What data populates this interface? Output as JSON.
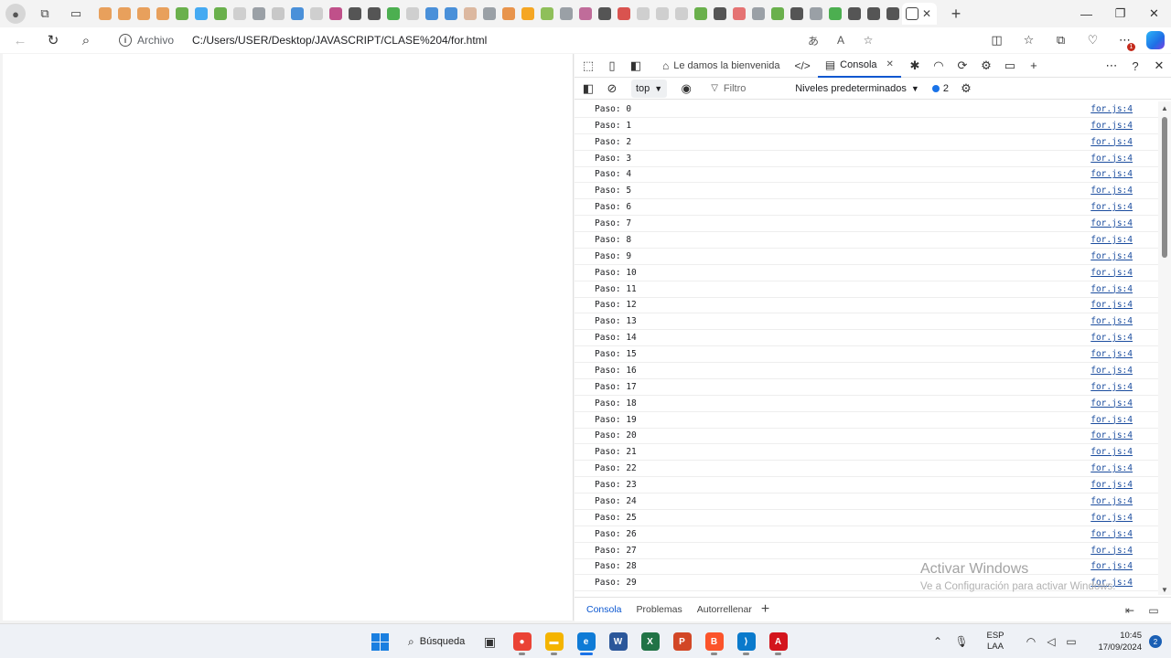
{
  "browser": {
    "back_icon": "arrow-left-icon",
    "reload_icon": "reload-icon",
    "search_icon": "search-icon",
    "site_info_label": "Archivo",
    "url": "C:/Users/USER/Desktop/JAVASCRIPT/CLASE%204/for.html",
    "window_controls": {
      "minimize": "—",
      "maximize": "❐",
      "close": "✕"
    }
  },
  "tabs": {
    "pinned_colors": [
      "#e8a05c",
      "#e8a05c",
      "#e8a05c",
      "#e8a05c",
      "#6ab04c",
      "#45aaf2",
      "#6ab04c",
      "#cfcfcf",
      "#9aa0a6",
      "#c8c8c8",
      "#4a90d9",
      "#cfcfcf",
      "#c0508a",
      "#555555",
      "#555555",
      "#4caf50",
      "#cfcfcf",
      "#4a90d9",
      "#4a90d9",
      "#dcb8a0",
      "#9aa0a6",
      "#e8944c",
      "#f5a623",
      "#8fbf5a",
      "#9aa0a6",
      "#c06c9a",
      "#555555",
      "#d9534f",
      "#cfcfcf",
      "#cfcfcf",
      "#cfcfcf",
      "#6ab04c",
      "#555555",
      "#e57373",
      "#9aa0a6",
      "#6ab04c",
      "#555555",
      "#9aa0a6",
      "#4caf50",
      "#555555",
      "#555555",
      "#555555"
    ],
    "close_glyph": "✕",
    "new_tab_glyph": "+"
  },
  "devtools": {
    "tabs": [
      {
        "label": "Le damos la bienvenida",
        "icon": "home-icon"
      },
      {
        "label": "",
        "icon": "code-icon"
      },
      {
        "label": "Consola",
        "icon": "console-icon",
        "active": true
      }
    ],
    "context": "top",
    "filter_placeholder": "Filtro",
    "levels": "Niveles predeterminados",
    "message_count": "2",
    "console": [
      {
        "text": "Paso: 0",
        "source": "for.js:4"
      },
      {
        "text": "Paso: 1",
        "source": "for.js:4"
      },
      {
        "text": "Paso: 2",
        "source": "for.js:4"
      },
      {
        "text": "Paso: 3",
        "source": "for.js:4"
      },
      {
        "text": "Paso: 4",
        "source": "for.js:4"
      },
      {
        "text": "Paso: 5",
        "source": "for.js:4"
      },
      {
        "text": "Paso: 6",
        "source": "for.js:4"
      },
      {
        "text": "Paso: 7",
        "source": "for.js:4"
      },
      {
        "text": "Paso: 8",
        "source": "for.js:4"
      },
      {
        "text": "Paso: 9",
        "source": "for.js:4"
      },
      {
        "text": "Paso: 10",
        "source": "for.js:4"
      },
      {
        "text": "Paso: 11",
        "source": "for.js:4"
      },
      {
        "text": "Paso: 12",
        "source": "for.js:4"
      },
      {
        "text": "Paso: 13",
        "source": "for.js:4"
      },
      {
        "text": "Paso: 14",
        "source": "for.js:4"
      },
      {
        "text": "Paso: 15",
        "source": "for.js:4"
      },
      {
        "text": "Paso: 16",
        "source": "for.js:4"
      },
      {
        "text": "Paso: 17",
        "source": "for.js:4"
      },
      {
        "text": "Paso: 18",
        "source": "for.js:4"
      },
      {
        "text": "Paso: 19",
        "source": "for.js:4"
      },
      {
        "text": "Paso: 20",
        "source": "for.js:4"
      },
      {
        "text": "Paso: 21",
        "source": "for.js:4"
      },
      {
        "text": "Paso: 22",
        "source": "for.js:4"
      },
      {
        "text": "Paso: 23",
        "source": "for.js:4"
      },
      {
        "text": "Paso: 24",
        "source": "for.js:4"
      },
      {
        "text": "Paso: 25",
        "source": "for.js:4"
      },
      {
        "text": "Paso: 26",
        "source": "for.js:4"
      },
      {
        "text": "Paso: 27",
        "source": "for.js:4"
      },
      {
        "text": "Paso: 28",
        "source": "for.js:4"
      },
      {
        "text": "Paso: 29",
        "source": "for.js:4"
      }
    ],
    "drawer_tabs": [
      "Consola",
      "Problemas",
      "Autorrellenar"
    ],
    "watermark_title": "Activar Windows",
    "watermark_sub": "Ve a Configuración para activar Windows."
  },
  "taskbar": {
    "search_label": "Búsqueda",
    "apps": [
      {
        "name": "taskview",
        "color": "#333333",
        "glyph": "▣"
      },
      {
        "name": "chrome",
        "color": "#ea4335",
        "glyph": "●"
      },
      {
        "name": "explorer",
        "color": "#f4b400",
        "glyph": "▬"
      },
      {
        "name": "edge",
        "color": "#0f7bd6",
        "glyph": "e"
      },
      {
        "name": "word",
        "color": "#2b579a",
        "glyph": "W"
      },
      {
        "name": "excel",
        "color": "#217346",
        "glyph": "X"
      },
      {
        "name": "powerpoint",
        "color": "#d24726",
        "glyph": "P"
      },
      {
        "name": "brave",
        "color": "#fb542b",
        "glyph": "B"
      },
      {
        "name": "vscode",
        "color": "#0a7acc",
        "glyph": "⟩"
      },
      {
        "name": "acrobat",
        "color": "#d3151d",
        "glyph": "A"
      }
    ],
    "lang_top": "ESP",
    "lang_bottom": "LAA",
    "time": "10:45",
    "date": "17/09/2024",
    "notifications": "2"
  }
}
